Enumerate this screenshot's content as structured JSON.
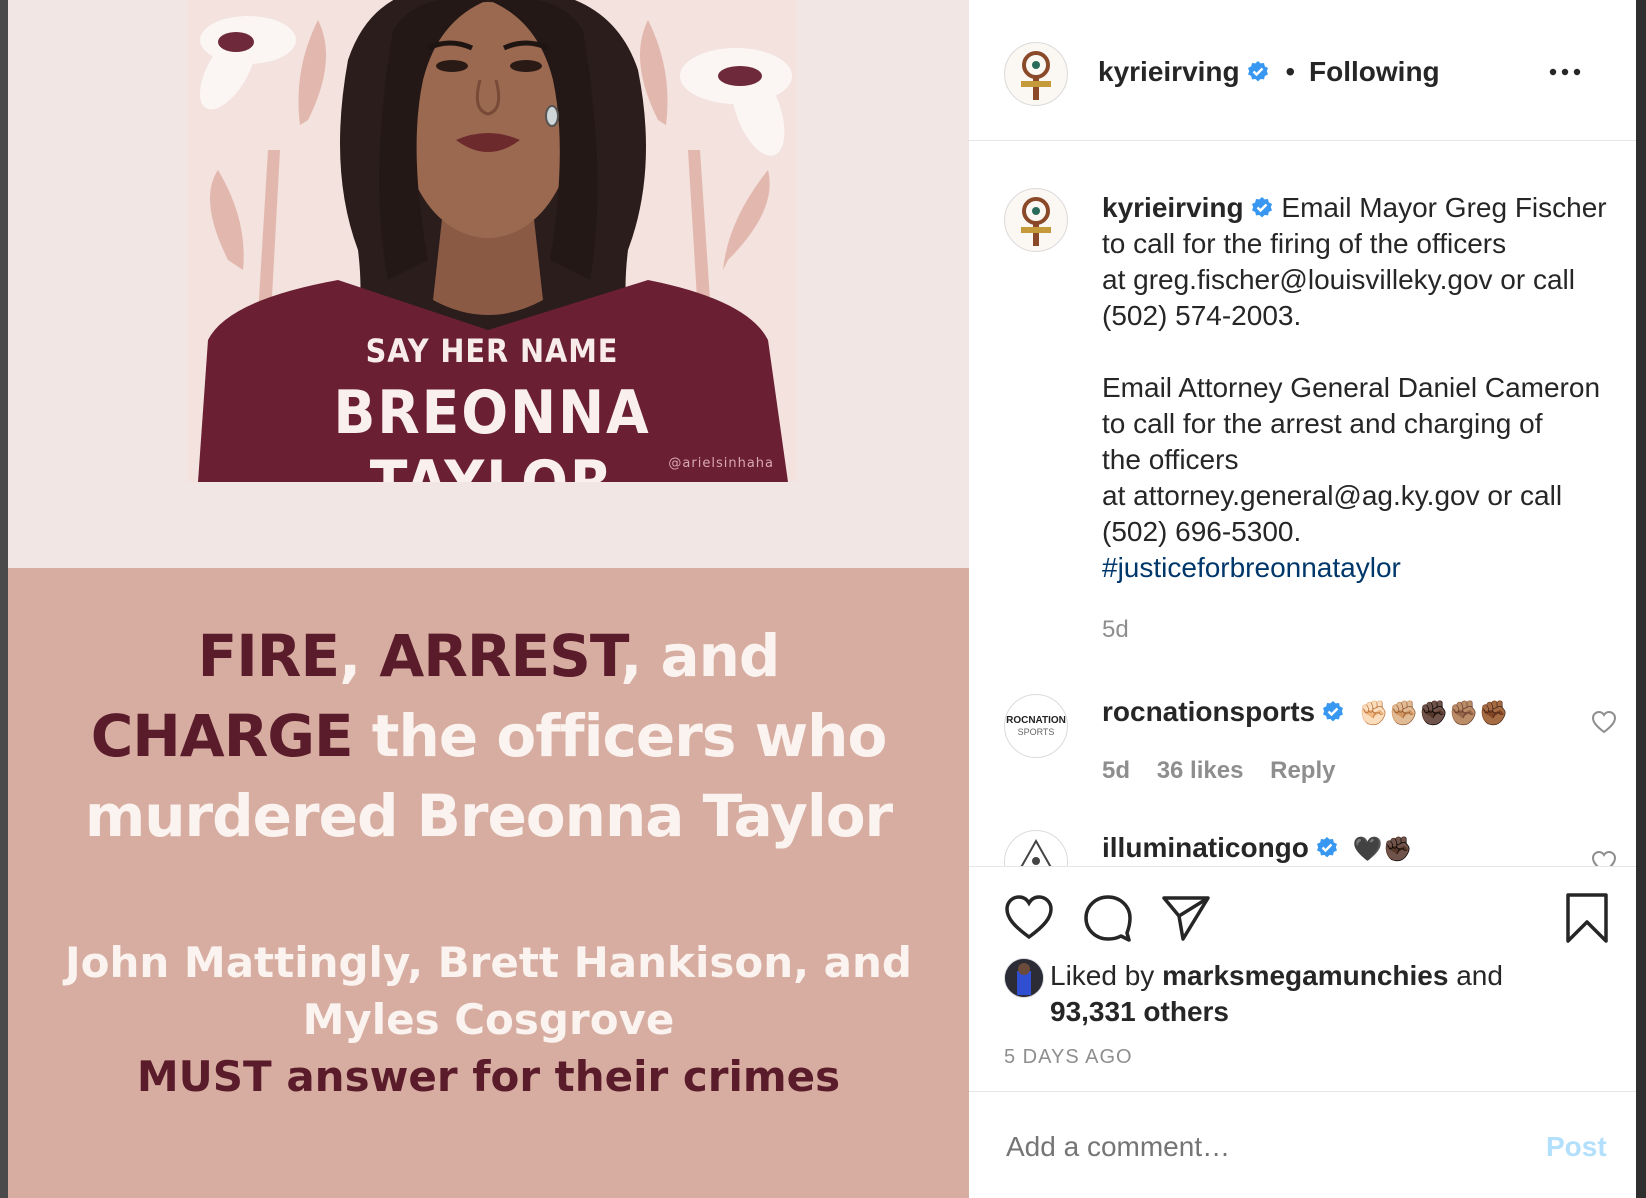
{
  "poster": {
    "say_her_name": "SAY HER NAME",
    "name": "BREONNA TAYLOR",
    "credit": "@arielsinhaha",
    "line1": {
      "a": "FIRE",
      "b": ",",
      "c": "ARREST",
      "d": ", and"
    },
    "line2": {
      "a": "CHARGE",
      "b": "the officers who"
    },
    "line3": "murdered Breonna Taylor",
    "line4": "John Mattingly, Brett Hankison, and",
    "line5": "Myles Cosgrove",
    "line6": {
      "a": "MUST",
      "b": "answer for their crimes"
    }
  },
  "header": {
    "username": "kyrieirving",
    "separator": "•",
    "follow_state": "Following",
    "more_icon": "more-icon"
  },
  "caption": {
    "username": "kyrieirving",
    "lines": [
      "Email Mayor Greg Fischer",
      "to call for the firing of the officers",
      "at greg.fischer@louisvilleky.gov or call",
      "(502) 574-2003.",
      "Email Attorney General Daniel Cameron",
      "to call for the arrest and charging of",
      "the officers",
      "at attorney.general@ag.ky.gov or call",
      "(502) 696-5300."
    ],
    "hashtag": "#justiceforbreonnataylor",
    "time": "5d"
  },
  "comments": [
    {
      "username": "rocnationsports",
      "avatar_text": "ROCNATION",
      "avatar_sub": "SPORTS",
      "text": "✊🏻✊🏼✊🏿✊🏽✊🏾",
      "time": "5d",
      "likes": "36 likes",
      "reply": "Reply"
    },
    {
      "username": "illuminaticongo",
      "text": "🖤✊🏿"
    }
  ],
  "actions": {
    "liked_by_prefix": "Liked by",
    "liked_by_user": "marksmegamunchies",
    "and": "and",
    "others": "93,331 others",
    "timestamp": "5 DAYS AGO"
  },
  "comment_box": {
    "placeholder": "Add a comment…",
    "post_label": "Post"
  },
  "colors": {
    "verified_blue": "#3897f0",
    "hashtag": "#00376b",
    "post_disabled": "#b2dffc",
    "poster_dark": "#5a1b2b",
    "poster_bg": "#d6ada0"
  }
}
